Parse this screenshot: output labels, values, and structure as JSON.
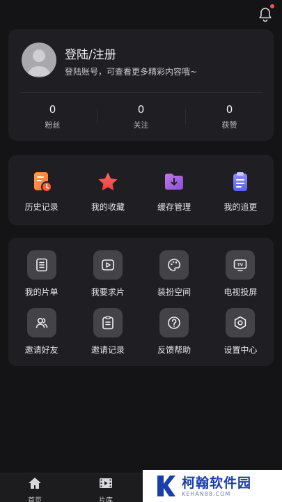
{
  "profile": {
    "name": "登陆/注册",
    "subtitle": "登陆账号，可查看更多精彩内容哦~",
    "stats": [
      {
        "value": "0",
        "label": "粉丝"
      },
      {
        "value": "0",
        "label": "关注"
      },
      {
        "value": "0",
        "label": "获赞"
      }
    ]
  },
  "quick_actions": [
    {
      "label": "历史记录",
      "icon": "history-icon",
      "color": "#ff7a45"
    },
    {
      "label": "我的收藏",
      "icon": "star-icon",
      "color": "#ff4d4f"
    },
    {
      "label": "缓存管理",
      "icon": "download-folder-icon",
      "color": "#9b59d6"
    },
    {
      "label": "我的追更",
      "icon": "clipboard-icon",
      "color": "#6d72f0"
    }
  ],
  "tools": [
    {
      "label": "我的片单",
      "icon": "list-icon"
    },
    {
      "label": "我要求片",
      "icon": "play-icon"
    },
    {
      "label": "装扮空间",
      "icon": "palette-icon"
    },
    {
      "label": "电视投屏",
      "icon": "tv-icon"
    },
    {
      "label": "邀请好友",
      "icon": "users-icon"
    },
    {
      "label": "邀请记录",
      "icon": "record-icon"
    },
    {
      "label": "反馈帮助",
      "icon": "help-icon"
    },
    {
      "label": "设置中心",
      "icon": "settings-icon"
    }
  ],
  "tabbar": {
    "home": "首页",
    "library": "片库"
  },
  "watermark": {
    "title": "柯翰软件园",
    "url": "KEHAN88.COM"
  }
}
